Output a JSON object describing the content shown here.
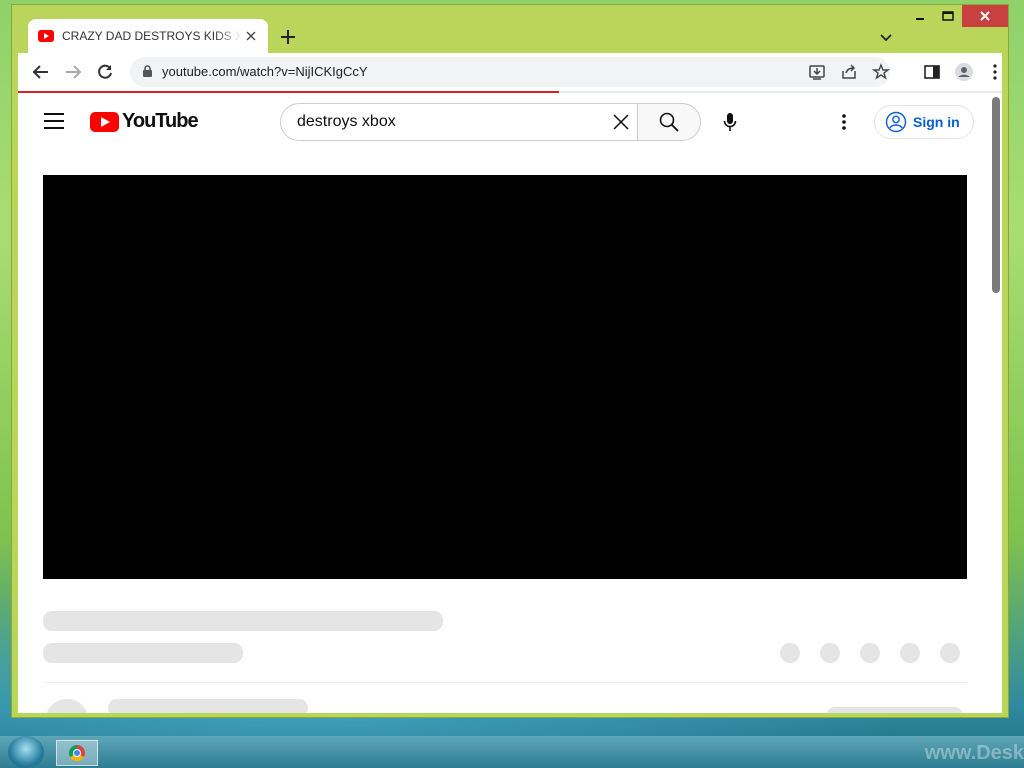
{
  "browser": {
    "tab_title": "CRAZY DAD DESTROYS KIDS XBOX",
    "url": "youtube.com/watch?v=NijICKIgCcY",
    "load_progress_percent": 55
  },
  "youtube": {
    "logo_text": "YouTube",
    "search_value": "destroys xbox",
    "signin_label": "Sign in"
  },
  "taskbar": {
    "watermark": "www.Desk"
  },
  "icons": {
    "tab_favicon": "youtube-favicon",
    "tab_close": "close-icon",
    "new_tab": "plus-icon",
    "tab_search": "chevron-down-icon",
    "back": "arrow-left-icon",
    "forward": "arrow-right-icon",
    "reload": "reload-icon",
    "lock": "lock-icon",
    "install": "install-icon",
    "share": "share-icon",
    "bookmark": "star-icon",
    "side_panel": "side-panel-icon",
    "profile": "profile-icon",
    "menu": "kebab-icon"
  },
  "colors": {
    "youtube_red": "#ff0000",
    "signin_blue": "#065fd4",
    "progress_red": "#e02020",
    "window_frame": "#b9d65a"
  }
}
